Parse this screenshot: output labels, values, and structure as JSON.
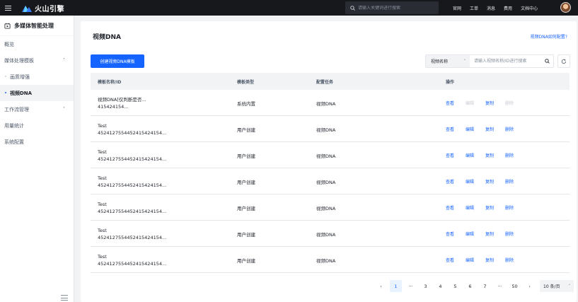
{
  "topbar": {
    "logo_text": "火山引擎",
    "search_placeholder": "请输入关键词进行搜索",
    "nav": [
      "官网",
      "工单",
      "消息",
      "费用",
      "文档中心"
    ]
  },
  "sidebar": {
    "title": "多媒体智能处理",
    "items": [
      {
        "label": "概览"
      },
      {
        "label": "媒体处理模板",
        "chevron": "˄"
      },
      {
        "label": "画质增强"
      },
      {
        "label": "视频DNA"
      },
      {
        "label": "工作流管理",
        "chevron": "˅"
      },
      {
        "label": "用量统计"
      },
      {
        "label": "系统配置"
      }
    ]
  },
  "page": {
    "title": "视频DNA",
    "help_link": "视频DNA如何配置?",
    "create_button": "创建视频DNA模板",
    "filter_field": "视频名称",
    "filter_placeholder": "请输入视频名称/ID进行搜索"
  },
  "table": {
    "columns": [
      "模板名称/ID",
      "模板类型",
      "配置任务",
      "操作"
    ],
    "rows": [
      {
        "name": "视频DNA[仅判断是否...",
        "id": "415424154...",
        "type": "系统内置",
        "task": "视频DNA"
      },
      {
        "name": "Test",
        "id": "452412755445241542415​4...",
        "type": "用户创建",
        "task": "视频DNA"
      },
      {
        "name": "Test",
        "id": "4524127554452415424154...",
        "type": "用户创建",
        "task": "视频DNA"
      },
      {
        "name": "Test",
        "id": "4524127554452415424154...",
        "type": "用户创建",
        "task": "视频DNA"
      },
      {
        "name": "Test",
        "id": "4524127554452415424154...",
        "type": "用户创建",
        "task": "视频DNA"
      },
      {
        "name": "Test",
        "id": "4524127554452415424154...",
        "type": "用户创建",
        "task": "视频DNA"
      },
      {
        "name": "Test",
        "id": "4524127554452415424154...",
        "type": "用户创建",
        "task": "视频DNA"
      }
    ],
    "actions": {
      "view": "查看",
      "edit": "编辑",
      "copy": "复制",
      "delete": "删除"
    }
  },
  "pagination": {
    "prev": "‹",
    "pages": [
      "1",
      "···",
      "3",
      "4",
      "5",
      "6",
      "7",
      "···",
      "50"
    ],
    "next": "›",
    "page_size": "10 条/页"
  },
  "colors": {
    "accent": "#1664ff",
    "topbar": "#17181c",
    "disabled": "#c9cdd4"
  }
}
